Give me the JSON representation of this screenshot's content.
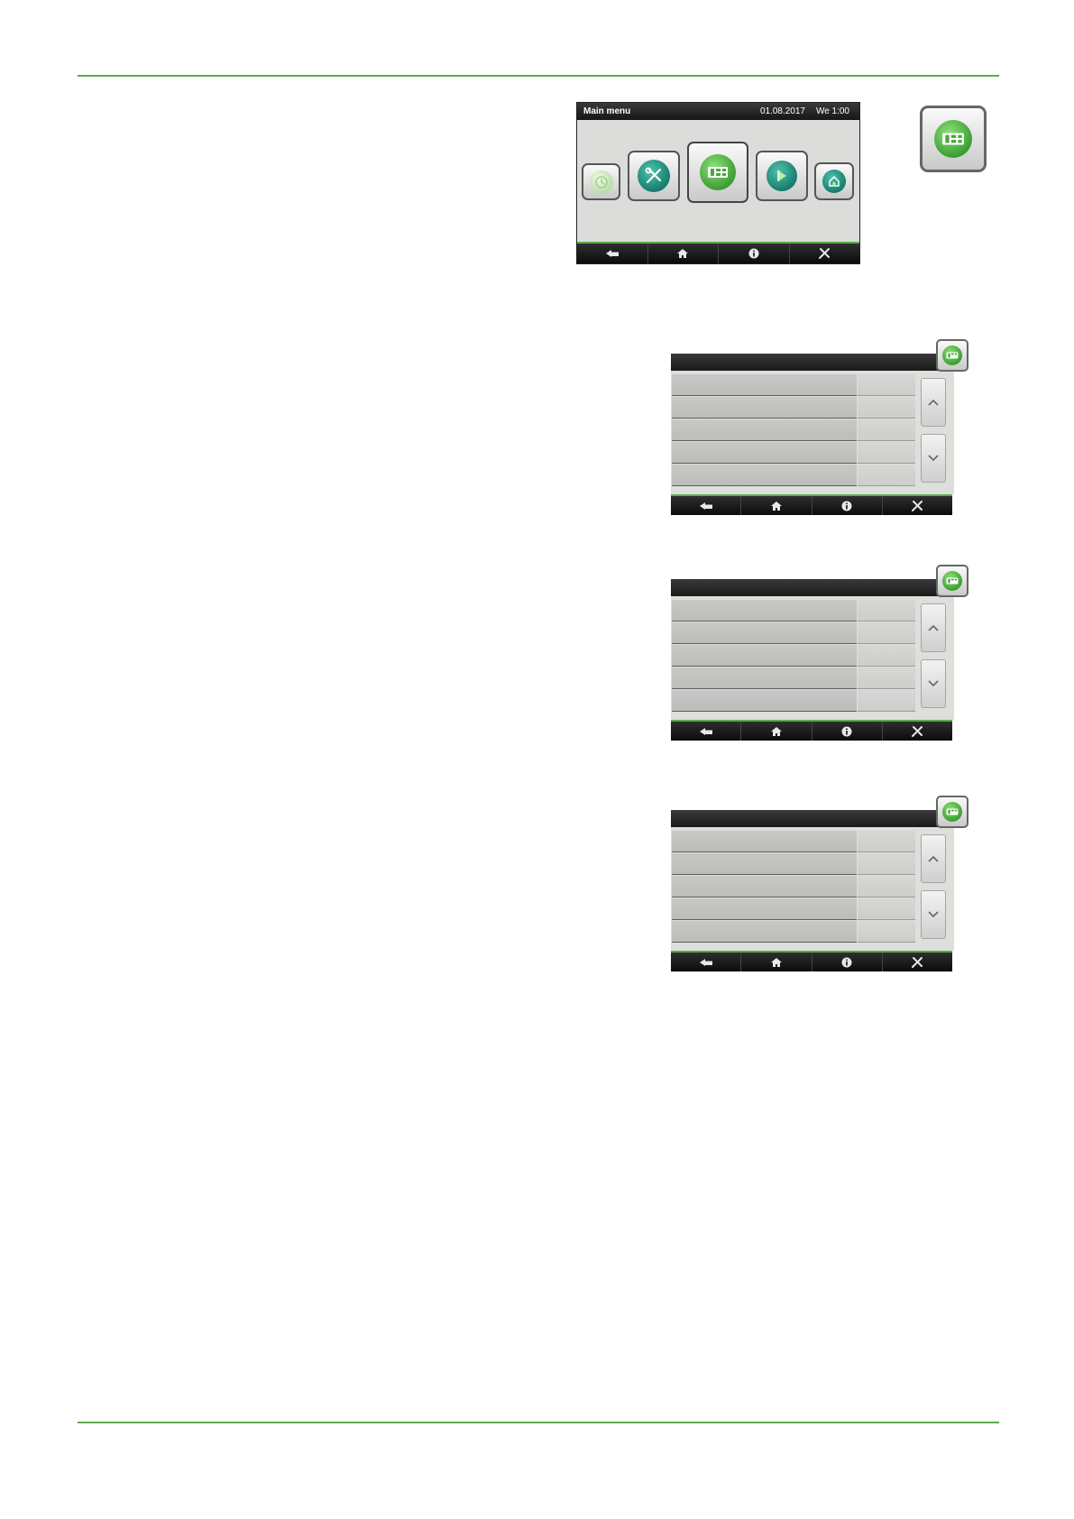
{
  "main_menu": {
    "title": "Main menu",
    "date": "01.08.2017",
    "time": "We 1:00",
    "tiles": [
      "clock-icon",
      "wrench-icon",
      "heating-module-icon",
      "play-icon",
      "house-icon"
    ]
  },
  "nav_bar": {
    "icons": [
      "back-arrow-icon",
      "home-icon",
      "info-icon",
      "tools-icon"
    ]
  },
  "list_screens": [
    {
      "rows": 5
    },
    {
      "rows": 5
    },
    {
      "rows": 5
    }
  ],
  "colors": {
    "accent_green": "#5aad4a",
    "teal": "#177d6d",
    "screen_bg": "#dcdcda",
    "header_dark": "#161616"
  }
}
